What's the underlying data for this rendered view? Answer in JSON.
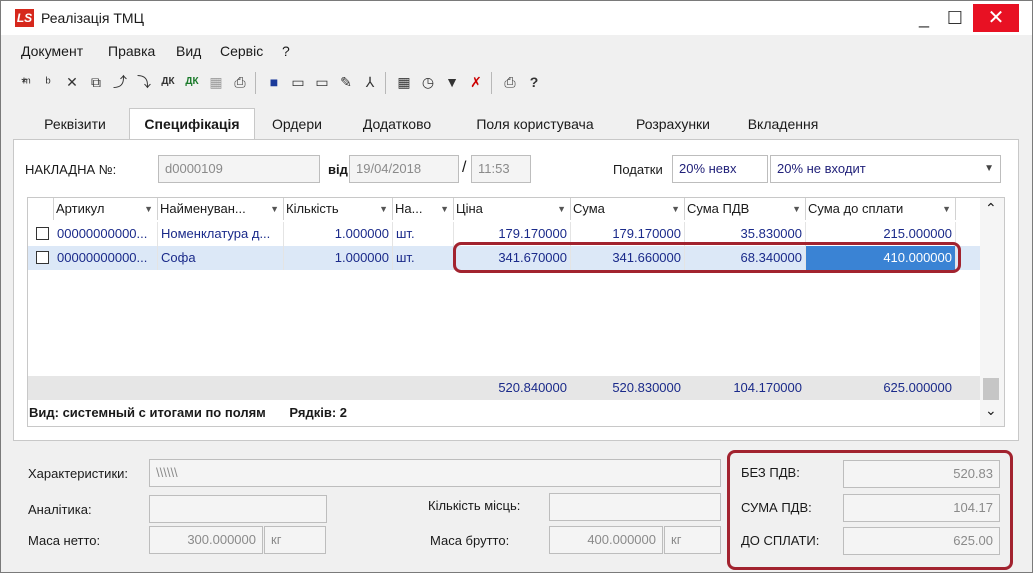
{
  "window": {
    "title": "Реалізація ТМЦ",
    "logo": "LS",
    "minimize": "_",
    "maximize": "☐",
    "close": "✕"
  },
  "menu": [
    "Документ",
    "Правка",
    "Вид",
    "Сервіс",
    "?"
  ],
  "toolbar": {
    "icons": [
      "new-doc-icon",
      "new-copy-icon",
      "delete-doc-icon",
      "copy-icon",
      "new-icon",
      "new2-icon",
      "dk-icon",
      "dk2-icon",
      "tax-icon",
      "print-prev-icon",
      "save-icon",
      "book-icon",
      "book2-icon",
      "edit-icon",
      "tree-icon",
      "table-icon",
      "time-icon",
      "filter-icon",
      "filter-clear-icon",
      "print-icon",
      "help-icon"
    ],
    "dk1": "ДК",
    "dk2": "ДК"
  },
  "tabs": [
    "Реквізити",
    "Специфікація",
    "Ордери",
    "Додатково",
    "Поля користувача",
    "Розрахунки",
    "Вкладення"
  ],
  "header": {
    "invoice_label": "НАКЛАДНА №:",
    "invoice_no": "d0000109",
    "from_label": "від",
    "date": "19/04/2018",
    "slash": "/",
    "time": "11:53",
    "taxes_label": "Податки",
    "tax1": "20% невх",
    "tax2": "20% не входит"
  },
  "grid": {
    "columns": [
      "Артикул",
      "Найменуван...",
      "Кількість",
      "На...",
      "Ціна",
      "Сума",
      "Сума ПДВ",
      "Сума до сплати"
    ],
    "rows": [
      {
        "article": "00000000000...",
        "name": "Номенклатура д...",
        "qty": "1.000000",
        "unit": "шт.",
        "price": "179.170000",
        "sum": "179.170000",
        "vat": "35.830000",
        "total": "215.000000"
      },
      {
        "article": "00000000000...",
        "name": "Софа",
        "qty": "1.000000",
        "unit": "шт.",
        "price": "341.670000",
        "sum": "341.660000",
        "vat": "68.340000",
        "total": "410.000000"
      }
    ],
    "totals": {
      "price": "520.840000",
      "sum": "520.830000",
      "vat": "104.170000",
      "total": "625.000000"
    },
    "view_info": "Вид: системный с итогами по полям",
    "rows_info": "Рядків: 2",
    "scroll_up": "⌃",
    "scroll_down": "⌄"
  },
  "footer": {
    "characteristics_label": "Характеристики:",
    "characteristics_value": "\\\\\\\\\\\\",
    "analytics_label": "Аналітика:",
    "places_label": "Кількість місць:",
    "net_label": "Маса нетто:",
    "net_value": "300.000000",
    "net_unit": "кг",
    "gross_label": "Маса брутто:",
    "gross_value": "400.000000",
    "gross_unit": "кг",
    "no_vat_label": "БЕЗ ПДВ:",
    "no_vat_value": "520.83",
    "vat_label": "СУМА ПДВ:",
    "vat_value": "104.17",
    "pay_label": "ДО СПЛАТИ:",
    "pay_value": "625.00"
  },
  "colors": {
    "accent": "#a2232f",
    "close": "#e81123",
    "selection": "#3a83d4"
  }
}
